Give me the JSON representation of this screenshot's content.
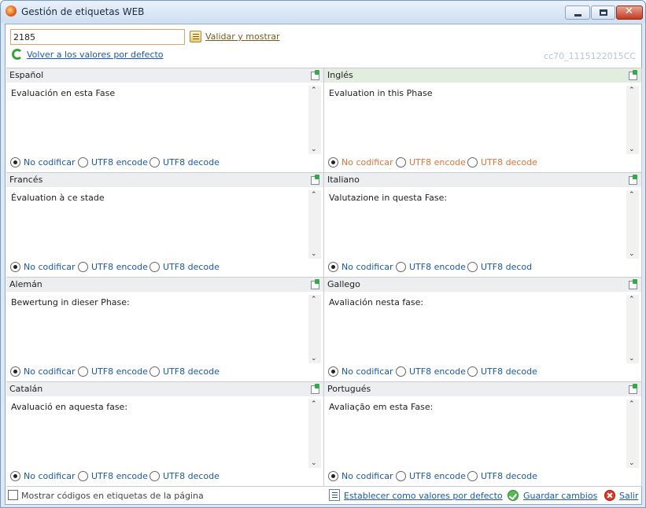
{
  "window": {
    "title": "Gestión de etiquetas WEB",
    "minimize_glyph": "",
    "maximize_glyph": "",
    "close_glyph": "✕"
  },
  "toolbar": {
    "code_value": "2185",
    "validate_label": "Validar y mostrar",
    "restore_label": "Volver a los valores por defecto",
    "code_id": "cc70_1115122015CC"
  },
  "panels": [
    {
      "language": "Español",
      "text": "Evaluación en esta Fase",
      "options": [
        "No codificar",
        "UTF8 encode",
        "UTF8 decode"
      ]
    },
    {
      "language": "Inglés",
      "text": "Evaluation in this Phase",
      "options": [
        "No codificar",
        "UTF8 encode",
        "UTF8 decode"
      ]
    },
    {
      "language": "Francés",
      "text": "Évaluation à ce stade",
      "options": [
        "No codificar",
        "UTF8 encode",
        "UTF8 decode"
      ]
    },
    {
      "language": "Italiano",
      "text": "Valutazione in questa Fase:",
      "options": [
        "No codificar",
        "UTF8 encode",
        "UTF8 decod"
      ]
    },
    {
      "language": "Alemán",
      "text": "Bewertung in dieser Phase:",
      "options": [
        "No codificar",
        "UTF8 encode",
        "UTF8 decode"
      ]
    },
    {
      "language": "Gallego",
      "text": "Avaliación nesta fase:",
      "options": [
        "No codificar",
        "UTF8 encode",
        "UTF8 decode"
      ]
    },
    {
      "language": "Catalán",
      "text": "Avaluació en aquesta fase:",
      "options": [
        "No codificar",
        "UTF8 encode",
        "UTF8 decode"
      ]
    },
    {
      "language": "Portugués",
      "text": "Avaliação em esta Fase:",
      "options": [
        "No codificar",
        "UTF8 encode",
        "UTF8 decode"
      ]
    }
  ],
  "scroll_glyphs": {
    "up": "⌃",
    "down": "⌄"
  },
  "footer": {
    "show_codes_label": "Mostrar códigos en etiquetas de la página",
    "set_defaults_label": "Establecer como valores por defecto",
    "save_label": "Guardar cambios",
    "exit_label": "Salir"
  },
  "colors": {
    "link": "#1a58b0",
    "active_option": "#e0733a",
    "active_header": "#e2ecdf",
    "header": "#eceef0"
  }
}
